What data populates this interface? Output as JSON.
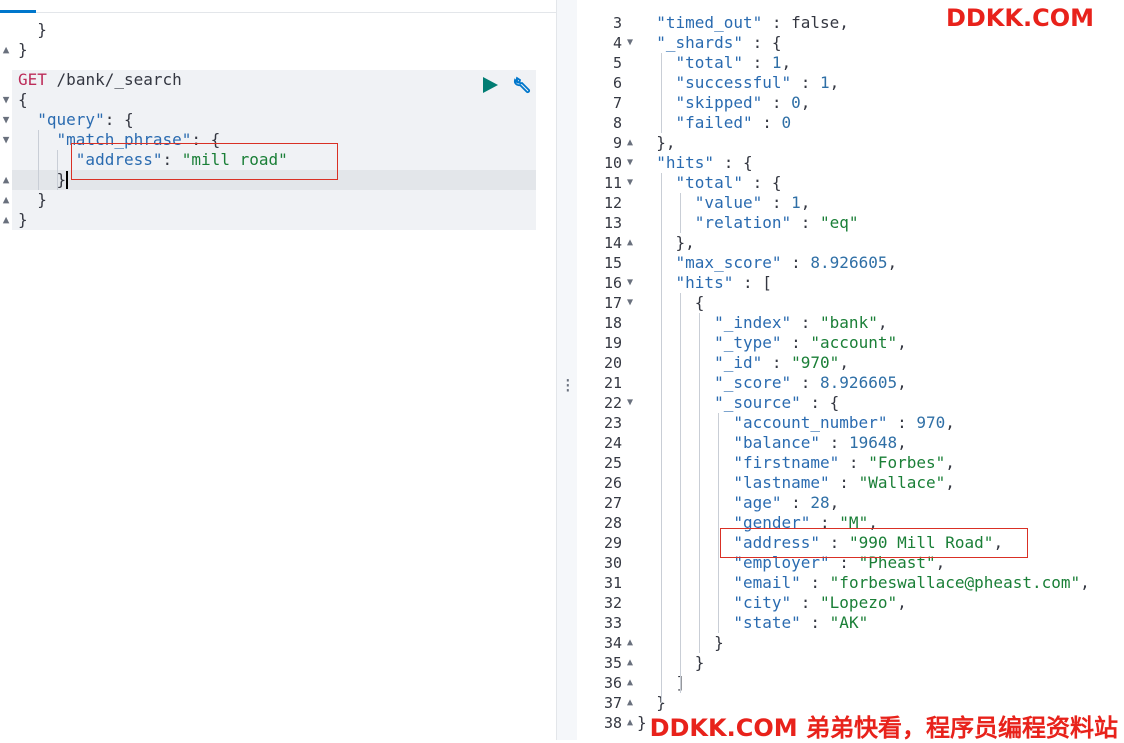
{
  "request": {
    "method": "GET",
    "path": "/bank/_search",
    "top_lines": [
      {
        "text": "  }",
        "fold": ""
      },
      {
        "text": "}",
        "fold": "▲"
      }
    ],
    "lines": [
      {
        "text": "{",
        "fold": "▼"
      },
      {
        "text": "  \"query\": {",
        "fold": "▼"
      },
      {
        "text": "    \"match_phrase\": {",
        "fold": "▼"
      },
      {
        "text": "      \"address\": \"mill road\"",
        "fold": ""
      },
      {
        "text": "    }",
        "fold": "▲"
      },
      {
        "text": "  }",
        "fold": "▲"
      },
      {
        "text": "}",
        "fold": "▲"
      }
    ]
  },
  "response": {
    "lines": [
      {
        "n": "3",
        "fold": "",
        "text": "  \"timed_out\" : false,"
      },
      {
        "n": "4",
        "fold": "▼",
        "text": "  \"_shards\" : {"
      },
      {
        "n": "5",
        "fold": "",
        "text": "    \"total\" : 1,"
      },
      {
        "n": "6",
        "fold": "",
        "text": "    \"successful\" : 1,"
      },
      {
        "n": "7",
        "fold": "",
        "text": "    \"skipped\" : 0,"
      },
      {
        "n": "8",
        "fold": "",
        "text": "    \"failed\" : 0"
      },
      {
        "n": "9",
        "fold": "▲",
        "text": "  },"
      },
      {
        "n": "10",
        "fold": "▼",
        "text": "  \"hits\" : {"
      },
      {
        "n": "11",
        "fold": "▼",
        "text": "    \"total\" : {"
      },
      {
        "n": "12",
        "fold": "",
        "text": "      \"value\" : 1,"
      },
      {
        "n": "13",
        "fold": "",
        "text": "      \"relation\" : \"eq\""
      },
      {
        "n": "14",
        "fold": "▲",
        "text": "    },"
      },
      {
        "n": "15",
        "fold": "",
        "text": "    \"max_score\" : 8.926605,"
      },
      {
        "n": "16",
        "fold": "▼",
        "text": "    \"hits\" : ["
      },
      {
        "n": "17",
        "fold": "▼",
        "text": "      {"
      },
      {
        "n": "18",
        "fold": "",
        "text": "        \"_index\" : \"bank\","
      },
      {
        "n": "19",
        "fold": "",
        "text": "        \"_type\" : \"account\","
      },
      {
        "n": "20",
        "fold": "",
        "text": "        \"_id\" : \"970\","
      },
      {
        "n": "21",
        "fold": "",
        "text": "        \"_score\" : 8.926605,"
      },
      {
        "n": "22",
        "fold": "▼",
        "text": "        \"_source\" : {"
      },
      {
        "n": "23",
        "fold": "",
        "text": "          \"account_number\" : 970,"
      },
      {
        "n": "24",
        "fold": "",
        "text": "          \"balance\" : 19648,"
      },
      {
        "n": "25",
        "fold": "",
        "text": "          \"firstname\" : \"Forbes\","
      },
      {
        "n": "26",
        "fold": "",
        "text": "          \"lastname\" : \"Wallace\","
      },
      {
        "n": "27",
        "fold": "",
        "text": "          \"age\" : 28,"
      },
      {
        "n": "28",
        "fold": "",
        "text": "          \"gender\" : \"M\","
      },
      {
        "n": "29",
        "fold": "",
        "text": "          \"address\" : \"990 Mill Road\","
      },
      {
        "n": "30",
        "fold": "",
        "text": "          \"employer\" : \"Pheast\","
      },
      {
        "n": "31",
        "fold": "",
        "text": "          \"email\" : \"forbeswallace@pheast.com\","
      },
      {
        "n": "32",
        "fold": "",
        "text": "          \"city\" : \"Lopezo\","
      },
      {
        "n": "33",
        "fold": "",
        "text": "          \"state\" : \"AK\""
      },
      {
        "n": "34",
        "fold": "▲",
        "text": "        }"
      },
      {
        "n": "35",
        "fold": "▲",
        "text": "      }"
      },
      {
        "n": "36",
        "fold": "▲",
        "text": "    ]"
      },
      {
        "n": "37",
        "fold": "▲",
        "text": "  }"
      },
      {
        "n": "38",
        "fold": "▲",
        "text": "}"
      }
    ]
  },
  "icons": {
    "run": "play-icon",
    "settings": "wrench-icon",
    "splitter": "vertical-dots-icon"
  },
  "watermarks": {
    "top": "DDKK.COM",
    "bottom": "DDKK.COM 弟弟快看，程序员编程资料站"
  },
  "colors": {
    "method": "#bd2d5a",
    "key": "#2a6bb0",
    "string": "#1a7f37",
    "run_button": "#017d73",
    "highlight": "#d93025",
    "watermark": "#e8221b"
  }
}
